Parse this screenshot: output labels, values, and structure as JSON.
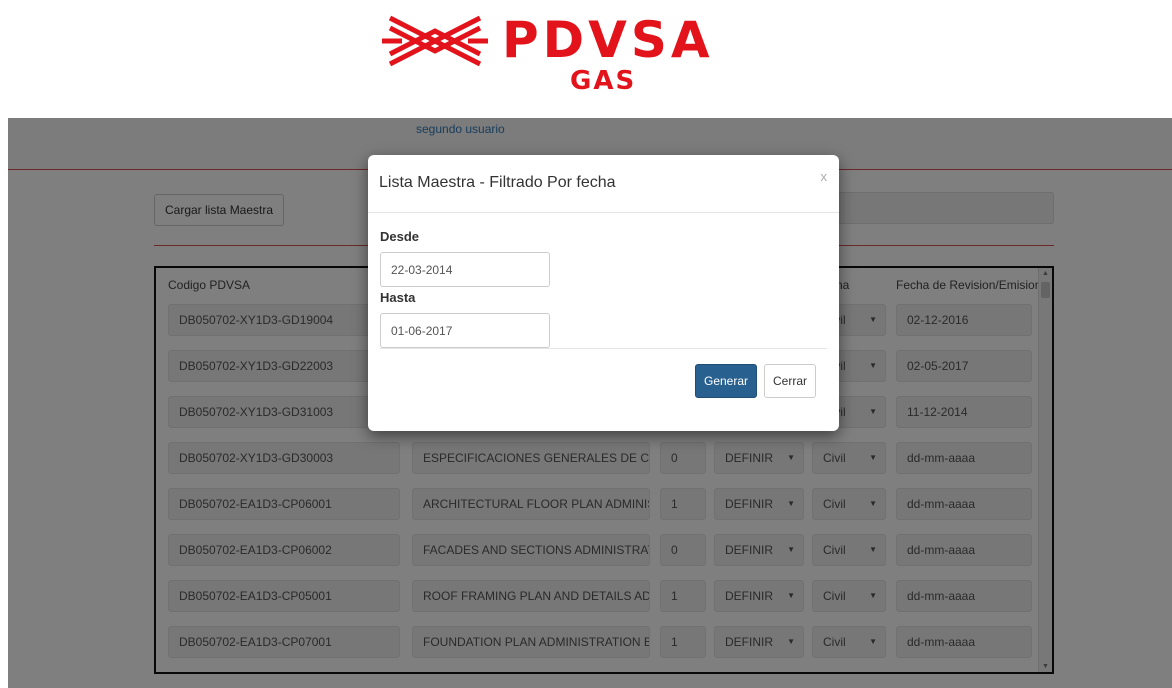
{
  "logo": {
    "word": "PDVSA",
    "sub": "GAS",
    "color": "#e3131b"
  },
  "navbar": {
    "user_link": "segundo usuario"
  },
  "toolbar": {
    "load_label": "Cargar lista Maestra"
  },
  "table": {
    "headers": [
      "Codigo PDVSA",
      "plina",
      "Fecha de Revision/Emision"
    ],
    "rows": [
      {
        "code": "DB050702-XY1D3-GD19004",
        "desc": "",
        "rev": "",
        "status": "",
        "disc": "Civil",
        "date": "02-12-2016"
      },
      {
        "code": "DB050702-XY1D3-GD22003",
        "desc": "",
        "rev": "",
        "status": "",
        "disc": "Civil",
        "date": "02-05-2017"
      },
      {
        "code": "DB050702-XY1D3-GD31003",
        "desc": "",
        "rev": "",
        "status": "",
        "disc": "Civil",
        "date": "11-12-2014"
      },
      {
        "code": "DB050702-XY1D3-GD30003",
        "desc": "ESPECIFICACIONES GENERALES DE CO",
        "rev": "0",
        "status": "DEFINIR",
        "disc": "Civil",
        "date": "dd-mm-aaaa"
      },
      {
        "code": "DB050702-EA1D3-CP06001",
        "desc": "ARCHITECTURAL FLOOR PLAN ADMINIS",
        "rev": "1",
        "status": "DEFINIR",
        "disc": "Civil",
        "date": "dd-mm-aaaa"
      },
      {
        "code": "DB050702-EA1D3-CP06002",
        "desc": "FACADES AND SECTIONS ADMINISTRATI",
        "rev": "0",
        "status": "DEFINIR",
        "disc": "Civil",
        "date": "dd-mm-aaaa"
      },
      {
        "code": "DB050702-EA1D3-CP05001",
        "desc": "ROOF FRAMING PLAN AND DETAILS ADM",
        "rev": "1",
        "status": "DEFINIR",
        "disc": "Civil",
        "date": "dd-mm-aaaa"
      },
      {
        "code": "DB050702-EA1D3-CP07001",
        "desc": "FOUNDATION PLAN ADMINISTRATION BU",
        "rev": "1",
        "status": "DEFINIR",
        "disc": "Civil",
        "date": "dd-mm-aaaa"
      }
    ]
  },
  "modal": {
    "title": "Lista Maestra - Filtrado Por fecha",
    "close": "x",
    "from_label": "Desde",
    "from_value": "22-03-2014",
    "to_label": "Hasta",
    "to_value": "01-06-2017",
    "generate_label": "Generar",
    "close_label": "Cerrar"
  }
}
